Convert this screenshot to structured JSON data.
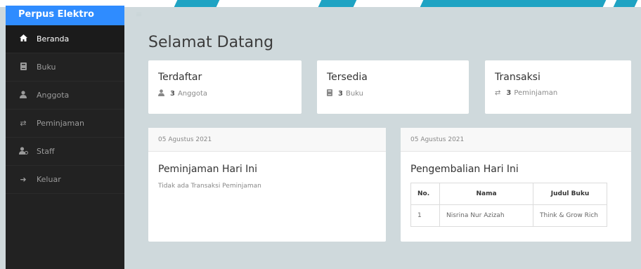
{
  "app": {
    "brand": "Perpus Elektro"
  },
  "sidebar": {
    "items": [
      {
        "label": "Beranda",
        "icon": "home-icon",
        "active": true
      },
      {
        "label": "Buku",
        "icon": "book-icon",
        "active": false
      },
      {
        "label": "Anggota",
        "icon": "user-icon",
        "active": false
      },
      {
        "label": "Peminjaman",
        "icon": "exchange-icon",
        "active": false
      },
      {
        "label": "Staff",
        "icon": "users-icon",
        "active": false
      },
      {
        "label": "Keluar",
        "icon": "sign-out-icon",
        "active": false
      }
    ]
  },
  "header": {
    "title": "Selamat Datang"
  },
  "stats": [
    {
      "title": "Terdaftar",
      "count": "3",
      "unit": "Anggota",
      "icon": "user-icon"
    },
    {
      "title": "Tersedia",
      "count": "3",
      "unit": "Buku",
      "icon": "book-icon"
    },
    {
      "title": "Transaksi",
      "count": "3",
      "unit": "Peminjaman",
      "icon": "exchange-icon"
    }
  ],
  "loans_panel": {
    "date": "05 Agustus 2021",
    "title": "Peminjaman Hari Ini",
    "empty_text": "Tidak ada Transaksi Peminjaman"
  },
  "returns_panel": {
    "date": "05 Agustus 2021",
    "title": "Pengembalian Hari Ini",
    "columns": [
      "No.",
      "Nama",
      "Judul Buku"
    ],
    "rows": [
      [
        "1",
        "Nisrina Nur Azizah",
        "Think & Grow Rich"
      ]
    ]
  },
  "colors": {
    "brand": "#2f8cff",
    "sidebar": "#222222",
    "background": "#cfd9dc"
  }
}
